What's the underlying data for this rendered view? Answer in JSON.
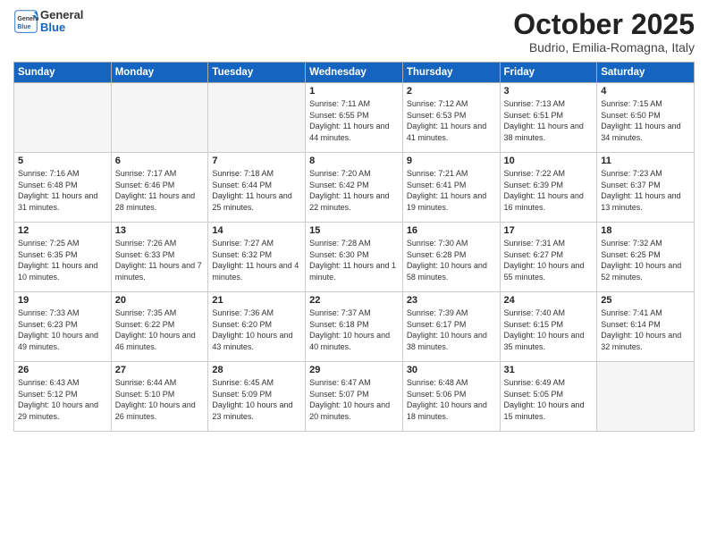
{
  "header": {
    "logo": {
      "general": "General",
      "blue": "Blue"
    },
    "title": "October 2025",
    "location": "Budrio, Emilia-Romagna, Italy"
  },
  "days_of_week": [
    "Sunday",
    "Monday",
    "Tuesday",
    "Wednesday",
    "Thursday",
    "Friday",
    "Saturday"
  ],
  "weeks": [
    [
      {
        "day": "",
        "info": ""
      },
      {
        "day": "",
        "info": ""
      },
      {
        "day": "",
        "info": ""
      },
      {
        "day": "1",
        "info": "Sunrise: 7:11 AM\nSunset: 6:55 PM\nDaylight: 11 hours and 44 minutes."
      },
      {
        "day": "2",
        "info": "Sunrise: 7:12 AM\nSunset: 6:53 PM\nDaylight: 11 hours and 41 minutes."
      },
      {
        "day": "3",
        "info": "Sunrise: 7:13 AM\nSunset: 6:51 PM\nDaylight: 11 hours and 38 minutes."
      },
      {
        "day": "4",
        "info": "Sunrise: 7:15 AM\nSunset: 6:50 PM\nDaylight: 11 hours and 34 minutes."
      }
    ],
    [
      {
        "day": "5",
        "info": "Sunrise: 7:16 AM\nSunset: 6:48 PM\nDaylight: 11 hours and 31 minutes."
      },
      {
        "day": "6",
        "info": "Sunrise: 7:17 AM\nSunset: 6:46 PM\nDaylight: 11 hours and 28 minutes."
      },
      {
        "day": "7",
        "info": "Sunrise: 7:18 AM\nSunset: 6:44 PM\nDaylight: 11 hours and 25 minutes."
      },
      {
        "day": "8",
        "info": "Sunrise: 7:20 AM\nSunset: 6:42 PM\nDaylight: 11 hours and 22 minutes."
      },
      {
        "day": "9",
        "info": "Sunrise: 7:21 AM\nSunset: 6:41 PM\nDaylight: 11 hours and 19 minutes."
      },
      {
        "day": "10",
        "info": "Sunrise: 7:22 AM\nSunset: 6:39 PM\nDaylight: 11 hours and 16 minutes."
      },
      {
        "day": "11",
        "info": "Sunrise: 7:23 AM\nSunset: 6:37 PM\nDaylight: 11 hours and 13 minutes."
      }
    ],
    [
      {
        "day": "12",
        "info": "Sunrise: 7:25 AM\nSunset: 6:35 PM\nDaylight: 11 hours and 10 minutes."
      },
      {
        "day": "13",
        "info": "Sunrise: 7:26 AM\nSunset: 6:33 PM\nDaylight: 11 hours and 7 minutes."
      },
      {
        "day": "14",
        "info": "Sunrise: 7:27 AM\nSunset: 6:32 PM\nDaylight: 11 hours and 4 minutes."
      },
      {
        "day": "15",
        "info": "Sunrise: 7:28 AM\nSunset: 6:30 PM\nDaylight: 11 hours and 1 minute."
      },
      {
        "day": "16",
        "info": "Sunrise: 7:30 AM\nSunset: 6:28 PM\nDaylight: 10 hours and 58 minutes."
      },
      {
        "day": "17",
        "info": "Sunrise: 7:31 AM\nSunset: 6:27 PM\nDaylight: 10 hours and 55 minutes."
      },
      {
        "day": "18",
        "info": "Sunrise: 7:32 AM\nSunset: 6:25 PM\nDaylight: 10 hours and 52 minutes."
      }
    ],
    [
      {
        "day": "19",
        "info": "Sunrise: 7:33 AM\nSunset: 6:23 PM\nDaylight: 10 hours and 49 minutes."
      },
      {
        "day": "20",
        "info": "Sunrise: 7:35 AM\nSunset: 6:22 PM\nDaylight: 10 hours and 46 minutes."
      },
      {
        "day": "21",
        "info": "Sunrise: 7:36 AM\nSunset: 6:20 PM\nDaylight: 10 hours and 43 minutes."
      },
      {
        "day": "22",
        "info": "Sunrise: 7:37 AM\nSunset: 6:18 PM\nDaylight: 10 hours and 40 minutes."
      },
      {
        "day": "23",
        "info": "Sunrise: 7:39 AM\nSunset: 6:17 PM\nDaylight: 10 hours and 38 minutes."
      },
      {
        "day": "24",
        "info": "Sunrise: 7:40 AM\nSunset: 6:15 PM\nDaylight: 10 hours and 35 minutes."
      },
      {
        "day": "25",
        "info": "Sunrise: 7:41 AM\nSunset: 6:14 PM\nDaylight: 10 hours and 32 minutes."
      }
    ],
    [
      {
        "day": "26",
        "info": "Sunrise: 6:43 AM\nSunset: 5:12 PM\nDaylight: 10 hours and 29 minutes."
      },
      {
        "day": "27",
        "info": "Sunrise: 6:44 AM\nSunset: 5:10 PM\nDaylight: 10 hours and 26 minutes."
      },
      {
        "day": "28",
        "info": "Sunrise: 6:45 AM\nSunset: 5:09 PM\nDaylight: 10 hours and 23 minutes."
      },
      {
        "day": "29",
        "info": "Sunrise: 6:47 AM\nSunset: 5:07 PM\nDaylight: 10 hours and 20 minutes."
      },
      {
        "day": "30",
        "info": "Sunrise: 6:48 AM\nSunset: 5:06 PM\nDaylight: 10 hours and 18 minutes."
      },
      {
        "day": "31",
        "info": "Sunrise: 6:49 AM\nSunset: 5:05 PM\nDaylight: 10 hours and 15 minutes."
      },
      {
        "day": "",
        "info": ""
      }
    ]
  ]
}
